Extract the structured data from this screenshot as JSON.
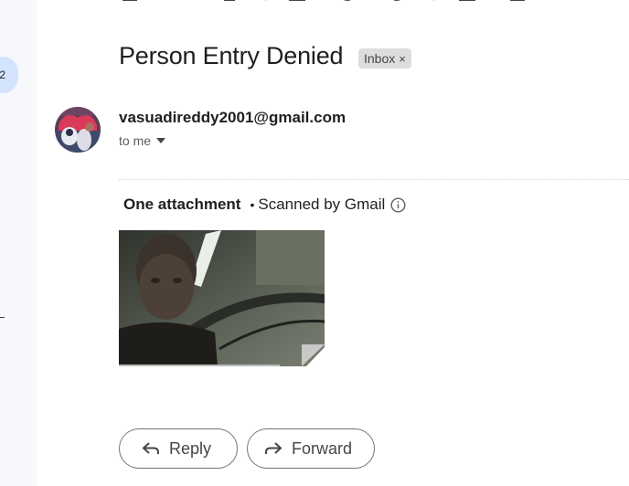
{
  "nav": {
    "badge_count": "2"
  },
  "email": {
    "subject": "Person Entry Denied",
    "label": "Inbox",
    "label_remove": "×",
    "sender": "vasuadireddy2001@gmail.com",
    "recipient": "to me"
  },
  "attachments": {
    "title": "One attachment",
    "separator": "•",
    "scanned": "Scanned by Gmail"
  },
  "actions": {
    "reply_label": "Reply",
    "forward_label": "Forward"
  },
  "icons": {
    "recipient_dropdown": "caret-down-icon",
    "info": "info-icon",
    "reply": "reply-arrow-icon",
    "forward": "forward-arrow-icon"
  },
  "colors": {
    "nav_bg": "#f6f8fc",
    "badge_bg": "#d3e3fd",
    "chip_bg": "#dddddd",
    "text": "#1f1f1f",
    "muted": "#444746"
  }
}
